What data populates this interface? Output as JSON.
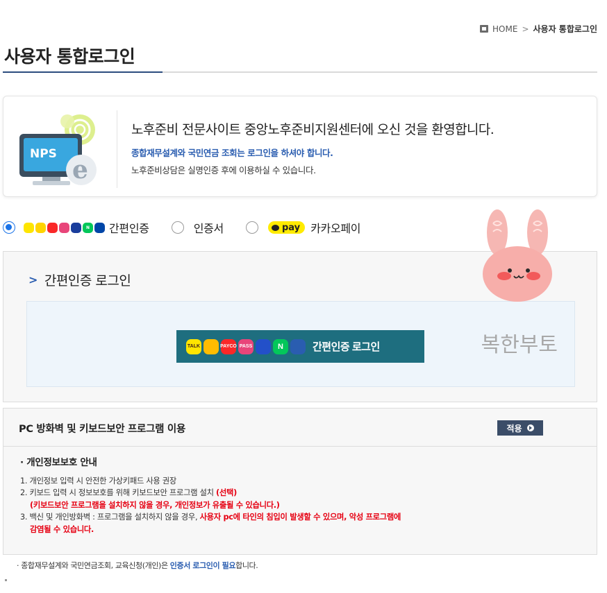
{
  "breadcrumb": {
    "home": "HOME",
    "separator": ">",
    "current": "사용자 통합로그인"
  },
  "page": {
    "title": "사용자 통합로그인"
  },
  "welcome": {
    "logo_text": "NPS",
    "title": "노후준비 전문사이트 중앙노후준비지원센터에 오신 것을 환영합니다.",
    "line1": "종합재무설계와 국민연금 조회는 로그인을 하셔야 합니다.",
    "line2": "노후준비상담은 실명인증 후에 이용하실 수 있습니다."
  },
  "auth_options": {
    "selected": "easy",
    "easy_label": "간편인증",
    "cert_label": "인증서",
    "kakao_label": "카카오페이",
    "kakao_badge": "pay"
  },
  "chips": [
    {
      "name": "kakao-icon",
      "text": "",
      "color": "#fee500"
    },
    {
      "name": "tosspay-icon",
      "text": "",
      "color": "#ffd400"
    },
    {
      "name": "payco-icon",
      "text": "PAYCO",
      "color": "#fa2828"
    },
    {
      "name": "pass-icon",
      "text": "PASS",
      "color": "#e8457a"
    },
    {
      "name": "samsungpass-icon",
      "text": "",
      "color": "#1a3d9c"
    },
    {
      "name": "naver-icon",
      "text": "N",
      "color": "#03c75a"
    },
    {
      "name": "shinhan-icon",
      "text": "",
      "color": "#0046a8"
    }
  ],
  "easy_login": {
    "heading": "간편인증 로그인",
    "button_label": "간편인증 로그인",
    "button_chips": [
      {
        "name": "kakao-talk-icon",
        "text": "TALK",
        "color": "#fee500"
      },
      {
        "name": "kb-icon",
        "text": "",
        "color": "#ffbc00"
      },
      {
        "name": "payco-icon",
        "text": "PAYCO",
        "color": "#fa2828"
      },
      {
        "name": "pass-icon",
        "text": "PASS",
        "color": "#e8457a"
      },
      {
        "name": "samsungpass-icon",
        "text": "",
        "color": "#2350c9"
      },
      {
        "name": "naver-icon",
        "text": "N",
        "color": "#03c75a"
      },
      {
        "name": "shinhan-icon",
        "text": "",
        "color": "#2a5db0"
      }
    ]
  },
  "sticker": {
    "caption": "행복한부토"
  },
  "security": {
    "title": "PC 방화벽 및 키보드보안 프로그램 이용",
    "apply_label": "적용",
    "notice_title": "· 개인정보보호 안내",
    "item1": "1. 개인정보 입력 시 안전한 가상키패드 사용 권장",
    "item2_prefix": "2. 키보드 입력 시 정보보호를 위해 키보드보안 프로그램 설치 ",
    "item2_red": "(선택)",
    "item2_red_line": "(키보드보안 프로그램을 설치하지 않을 경우, 개인정보가 유출될 수 있습니다.)",
    "item3_prefix": "3. 백신 및 개인방화벽 : 프로그램을 설치하지 않을 경우, ",
    "item3_red": "사용자 pc에 타인의 침입이 발생할 수 있으며, 악성 프로그램에",
    "item3_red_line": "감염될 수 있습니다."
  },
  "footnote": {
    "prefix": "· 종합재무설계와 국민연금조회, 교육신청(개인)은 ",
    "highlight": "인증서 로그인이 필요",
    "suffix": "합니다."
  }
}
